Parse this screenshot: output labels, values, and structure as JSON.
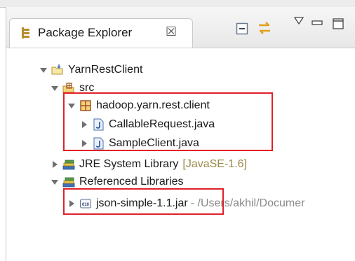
{
  "view": {
    "tab_title": "Package Explorer",
    "tab_close_glyph": "☒"
  },
  "tree": {
    "project": "YarnRestClient",
    "src": "src",
    "package": "hadoop.yarn.rest.client",
    "file1": "CallableRequest.java",
    "file2": "SampleClient.java",
    "jre_label": "JRE System Library",
    "jre_decoration": "[JavaSE-1.6]",
    "ref_libs": "Referenced Libraries",
    "jar_name": "json-simple-1.1.jar",
    "jar_path": "- /Users/akhil/Documer",
    "jar_icon_text": "010"
  },
  "icons": {
    "tab": "package-explorer-icon",
    "collapse": "collapse-all-icon",
    "link": "link-with-editor-icon",
    "menu": "view-menu-icon",
    "minimize": "minimize-icon",
    "maximize": "maximize-icon"
  },
  "colors": {
    "highlight": "#e0202a",
    "decoration": "#9a8a4a",
    "path": "#8a8a8a"
  }
}
